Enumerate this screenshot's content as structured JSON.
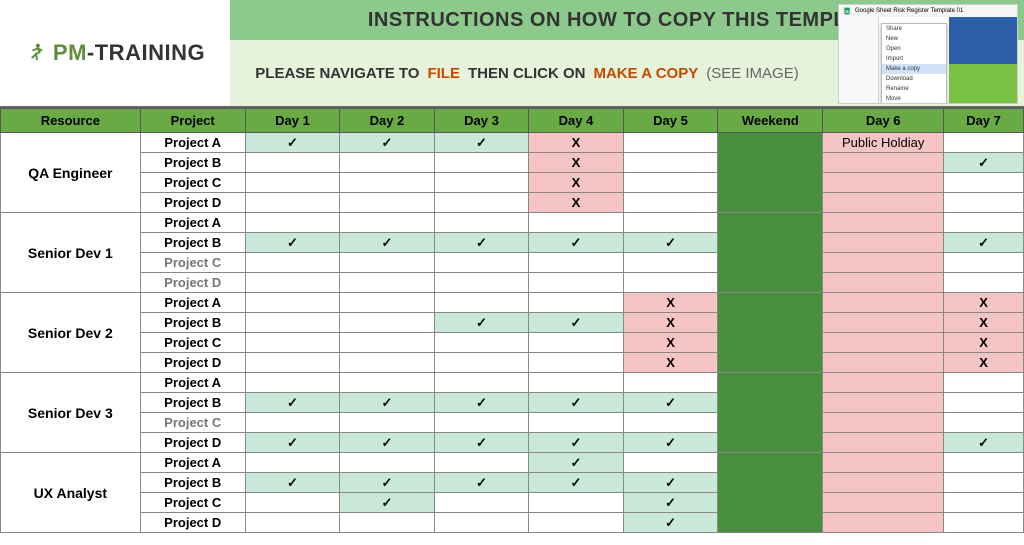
{
  "logo": {
    "text1": "PM",
    "text2": "-TRAINING"
  },
  "banner": {
    "title": "INSTRUCTIONS ON HOW TO COPY THIS TEMPLATE",
    "instr_pre": "PLEASE NAVIGATE TO",
    "instr_file": "FILE",
    "instr_mid": "THEN CLICK ON",
    "instr_copy": "MAKE A COPY",
    "instr_see": "(SEE IMAGE)"
  },
  "thumb": {
    "title": "Google Sheet Risk Register Template 01",
    "menu": [
      "Share",
      "New",
      "Open",
      "Import",
      "Make a copy",
      "Download",
      "Rename",
      "Move"
    ]
  },
  "headers": {
    "resource": "Resource",
    "project": "Project",
    "d1": "Day 1",
    "d2": "Day 2",
    "d3": "Day 3",
    "d4": "Day 4",
    "d5": "Day 5",
    "weekend": "Weekend",
    "d6": "Day 6",
    "d7": "Day 7"
  },
  "marks": {
    "check": "✓",
    "x": "X"
  },
  "d6_label": "Public Holdiay",
  "resources": [
    {
      "name": "QA Engineer",
      "rows": [
        {
          "project": "Project A",
          "d1": "check",
          "d2": "check",
          "d3": "check",
          "d4": "x",
          "d5": "",
          "d7": "",
          "first": true
        },
        {
          "project": "Project B",
          "d1": "",
          "d2": "",
          "d3": "",
          "d4": "x",
          "d5": "",
          "d7": "check"
        },
        {
          "project": "Project C",
          "d1": "",
          "d2": "",
          "d3": "",
          "d4": "x",
          "d5": "",
          "d7": ""
        },
        {
          "project": "Project D",
          "d1": "",
          "d2": "",
          "d3": "",
          "d4": "x",
          "d5": "",
          "d7": ""
        }
      ]
    },
    {
      "name": "Senior Dev 1",
      "rows": [
        {
          "project": "Project A",
          "d1": "",
          "d2": "",
          "d3": "",
          "d4": "",
          "d5": "",
          "d7": ""
        },
        {
          "project": "Project B",
          "d1": "check",
          "d2": "check",
          "d3": "check",
          "d4": "check",
          "d5": "check",
          "d7": "check"
        },
        {
          "project": "Project C",
          "subtle": true,
          "d1": "",
          "d2": "",
          "d3": "",
          "d4": "",
          "d5": "",
          "d7": ""
        },
        {
          "project": "Project D",
          "subtle": true,
          "d1": "",
          "d2": "",
          "d3": "",
          "d4": "",
          "d5": "",
          "d7": ""
        }
      ]
    },
    {
      "name": "Senior Dev 2",
      "rows": [
        {
          "project": "Project A",
          "d1": "",
          "d2": "",
          "d3": "",
          "d4": "",
          "d5": "x",
          "d7": "x"
        },
        {
          "project": "Project B",
          "d1": "",
          "d2": "",
          "d3": "check",
          "d4": "check",
          "d5": "x",
          "d7": "x"
        },
        {
          "project": "Project C",
          "d1": "",
          "d2": "",
          "d3": "",
          "d4": "",
          "d5": "x",
          "d7": "x"
        },
        {
          "project": "Project D",
          "d1": "",
          "d2": "",
          "d3": "",
          "d4": "",
          "d5": "x",
          "d7": "x"
        }
      ]
    },
    {
      "name": "Senior Dev 3",
      "rows": [
        {
          "project": "Project A",
          "d1": "",
          "d2": "",
          "d3": "",
          "d4": "",
          "d5": "",
          "d7": ""
        },
        {
          "project": "Project B",
          "d1": "check",
          "d2": "check",
          "d3": "check",
          "d4": "check",
          "d5": "check",
          "d7": ""
        },
        {
          "project": "Project C",
          "subtle": true,
          "d1": "",
          "d2": "",
          "d3": "",
          "d4": "",
          "d5": "",
          "d7": ""
        },
        {
          "project": "Project D",
          "d1": "check",
          "d2": "check",
          "d3": "check",
          "d4": "check",
          "d5": "check",
          "d7": "check"
        }
      ]
    },
    {
      "name": "UX Analyst",
      "rows": [
        {
          "project": "Project A",
          "d1": "",
          "d2": "",
          "d3": "",
          "d4": "check",
          "d5": "",
          "d7": ""
        },
        {
          "project": "Project B",
          "d1": "check",
          "d2": "check",
          "d3": "check",
          "d4": "check",
          "d5": "check",
          "d7": ""
        },
        {
          "project": "Project C",
          "d1": "",
          "d2": "check",
          "d3": "",
          "d4": "",
          "d5": "check",
          "d7": ""
        },
        {
          "project": "Project D",
          "d1": "",
          "d2": "",
          "d3": "",
          "d4": "",
          "d5": "check",
          "d7": ""
        }
      ]
    }
  ]
}
